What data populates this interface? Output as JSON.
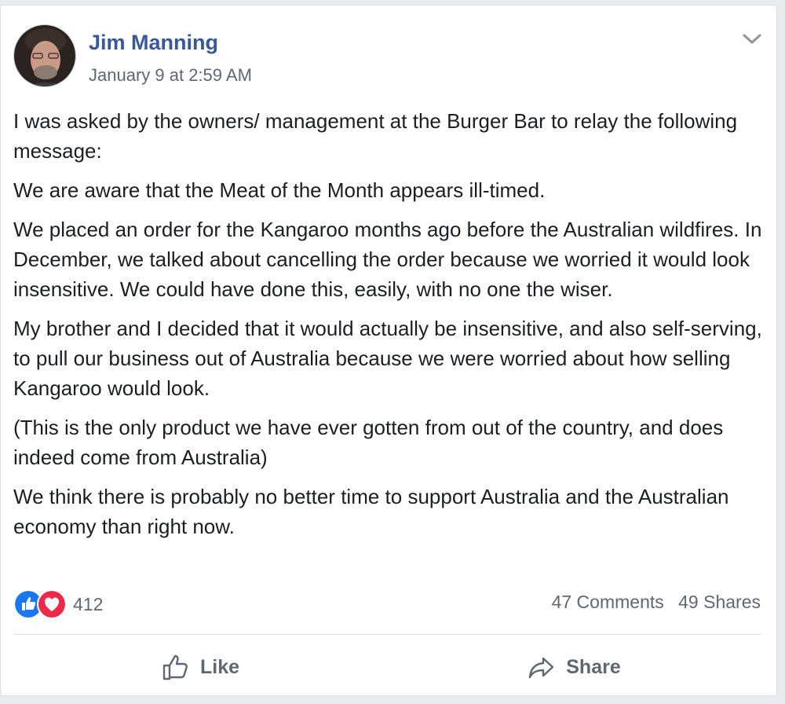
{
  "post": {
    "author": "Jim Manning",
    "timestamp": "January 9 at 2:59 AM",
    "paragraphs": [
      "I was asked by the owners/ management at the Burger Bar to relay the following message:",
      "We are aware that the Meat of the Month appears ill-timed.",
      "We placed an order for the Kangaroo months ago before the Australian wildfires. In December, we talked about cancelling the order because we worried it would look insensitive. We could have done this, easily, with no one the wiser.",
      "My brother and I decided that it would actually be insensitive, and also self-serving, to pull our business out of Australia because we were worried about how selling Kangaroo would look.",
      "(This is the only product we have ever gotten from out of the country, and does indeed come from Australia)",
      "We think there is probably no better time to support Australia and the Australian economy than right now."
    ]
  },
  "stats": {
    "reaction_count": "412",
    "comments": "47 Comments",
    "shares": "49 Shares"
  },
  "actions": {
    "like_label": "Like",
    "share_label": "Share"
  },
  "icons": {
    "reaction_like": "like-reaction-icon",
    "reaction_love": "love-reaction-icon",
    "like": "thumbs-up-icon",
    "share": "share-arrow-icon",
    "menu": "chevron-down-icon"
  },
  "colors": {
    "author": "#385898",
    "like_blue": "#1877f2",
    "love_red": "#f0284a",
    "text": "#1c1e21",
    "muted": "#606770"
  }
}
